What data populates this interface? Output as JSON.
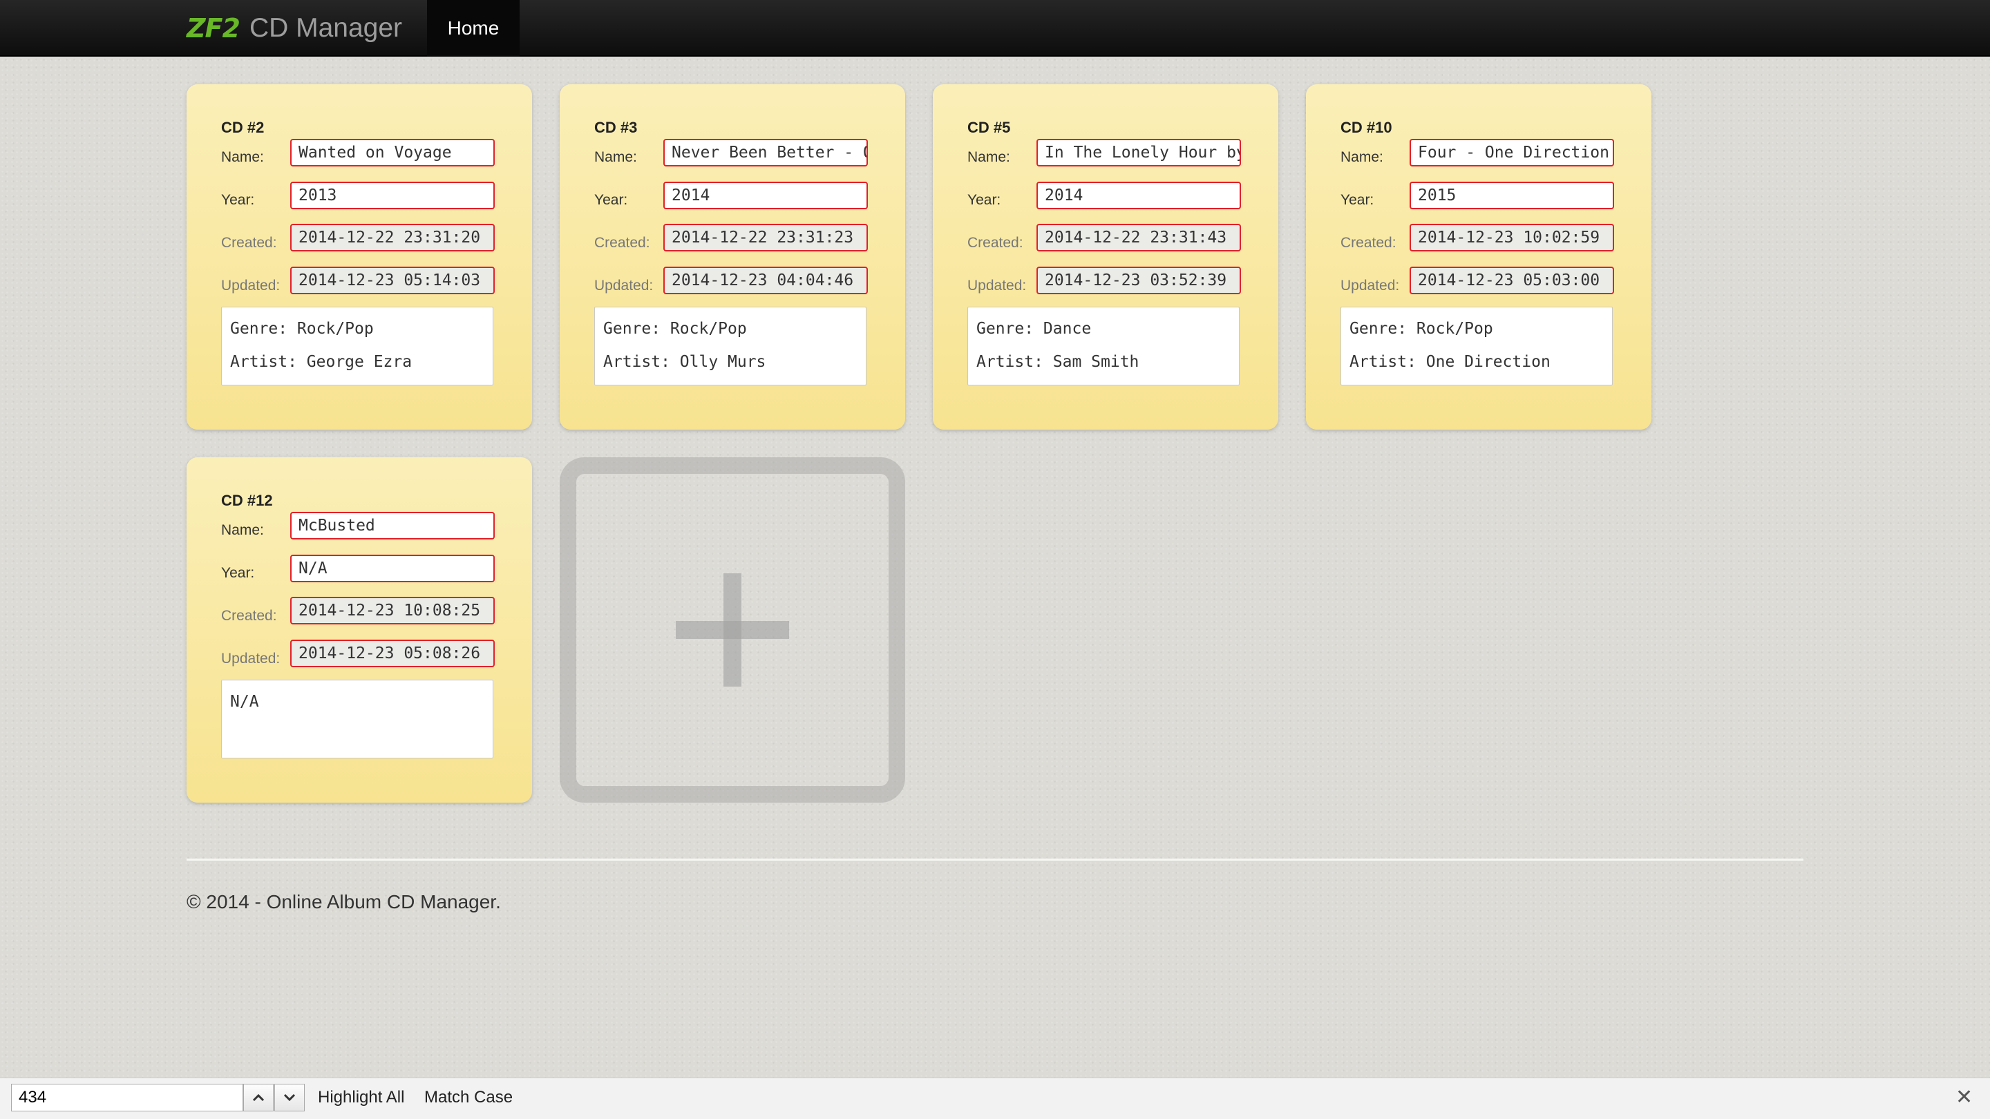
{
  "navbar": {
    "logo_text": "ZF2",
    "brand": "CD Manager",
    "home": "Home"
  },
  "labels": {
    "name": "Name:",
    "year": "Year:",
    "created": "Created:",
    "updated": "Updated:"
  },
  "cards": [
    {
      "title": "CD #2",
      "name": "Wanted on Voyage",
      "year": "2013",
      "created": "2014-12-22 23:31:20",
      "updated": "2014-12-23 05:14:03",
      "description": [
        "Genre: Rock/Pop",
        "Artist: George Ezra"
      ]
    },
    {
      "title": "CD #3",
      "name": "Never Been Better - Olly Murs",
      "year": "2014",
      "created": "2014-12-22 23:31:23",
      "updated": "2014-12-23 04:04:46",
      "description": [
        "Genre: Rock/Pop",
        "Artist: Olly Murs"
      ]
    },
    {
      "title": "CD #5",
      "name": "In The Lonely Hour by Sam Smith",
      "year": "2014",
      "created": "2014-12-22 23:31:43",
      "updated": "2014-12-23 03:52:39",
      "description": [
        "Genre: Dance",
        "Artist: Sam Smith"
      ]
    },
    {
      "title": "CD #10",
      "name": "Four - One Direction",
      "year": "2015",
      "created": "2014-12-23 10:02:59",
      "updated": "2014-12-23 05:03:00",
      "description": [
        "Genre: Rock/Pop",
        "Artist: One Direction"
      ]
    },
    {
      "title": "CD #12",
      "name": "McBusted",
      "year": "N/A",
      "created": "2014-12-23 10:08:25",
      "updated": "2014-12-23 05:08:26",
      "description": [
        "N/A",
        ""
      ]
    }
  ],
  "add_card": {
    "icon": "plus-icon"
  },
  "footer": {
    "text": "© 2014 - Online Album CD Manager."
  },
  "find_bar": {
    "query": "434",
    "highlight_all": "Highlight All",
    "match_case": "Match Case",
    "close_glyph": "✕",
    "up_icon": "chevron-up-icon",
    "down_icon": "chevron-down-icon"
  },
  "colors": {
    "card_bg": "#f9ea9f",
    "field_border": "#e3202a",
    "logo_green": "#68b828",
    "navbar_bg": "#1b1b1b"
  }
}
